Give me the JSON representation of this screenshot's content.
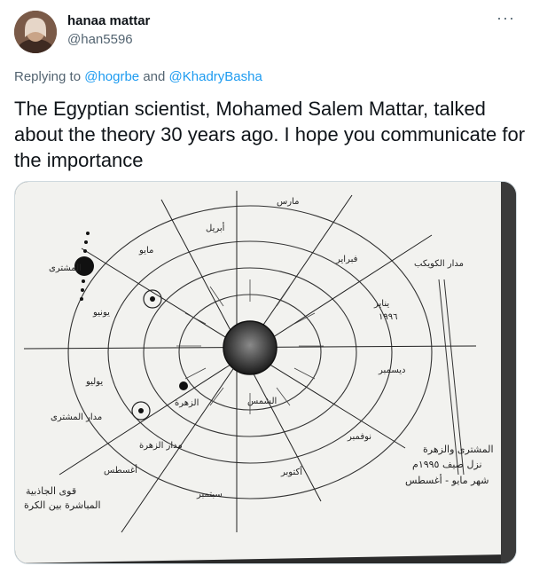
{
  "author": {
    "display_name": "hanaa mattar",
    "handle": "@han5596"
  },
  "more_icon": "more-options-icon",
  "reply": {
    "prefix": "Replying to ",
    "mention1": "@hogrbe",
    "and": " and ",
    "mention2": "@KhadryBasha"
  },
  "tweet_text": "The Egyptian scientist, Mohamed Salem Mattar, talked about the theory 30 years ago. I hope you communicate for the importance",
  "diagram_labels": {
    "jupiter": "المشترى",
    "venus": "الزهرة",
    "months": [
      "مارس",
      "أبريل",
      "مايو",
      "يونيو",
      "يوليو",
      "أغسطس",
      "سبتمبر",
      "أكتوبر",
      "نوفمبر",
      "ديسمبر",
      "يناير",
      "فبراير"
    ],
    "year": "١٩٩٦",
    "sun": "الشمس",
    "bottom_left_line1": "قوى الجاذبية",
    "bottom_left_line2": "المباشرة بين الكرة",
    "bottom_right_line1": "المشترى والزهرة",
    "bottom_right_line2": "نزل صيف ١٩٩٥م",
    "bottom_right_line3": "شهر مايو - أغسطس",
    "orbit_jupiter": "مدار المشترى",
    "orbit_venus": "مدار الزهرة",
    "comet": "مدار الكويكب"
  }
}
